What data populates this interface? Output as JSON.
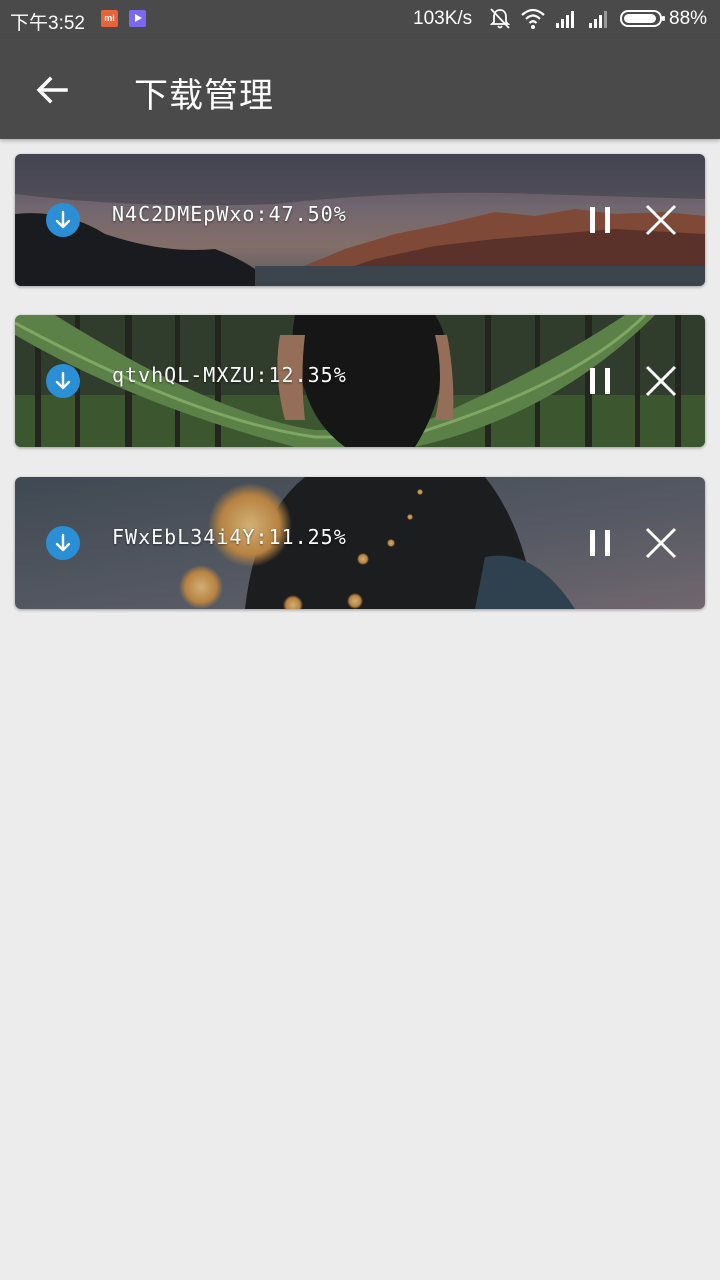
{
  "status_bar": {
    "time": "下午3:52",
    "mi_badge": "mi",
    "net_speed": "103K/s",
    "battery": "88%",
    "icons": [
      "mi-app-icon",
      "video-app-icon",
      "mute-icon",
      "wifi-icon",
      "signal-icon",
      "signal-icon",
      "battery-icon"
    ]
  },
  "app_bar": {
    "title": "下载管理",
    "back_icon": "arrow-back-icon"
  },
  "downloads": [
    {
      "label": "N4C2DMEpWxo:47.50%",
      "progress_percent": 47.5
    },
    {
      "label": "qtvhQL-MXZU:12.35%",
      "progress_percent": 12.35
    },
    {
      "label": "FWxEbL34i4Y:11.25%",
      "progress_percent": 11.25
    }
  ],
  "colors": {
    "bar_bg": "#4a4a4a",
    "page_bg": "#ececec",
    "accent_download": "#2b8fd6"
  }
}
